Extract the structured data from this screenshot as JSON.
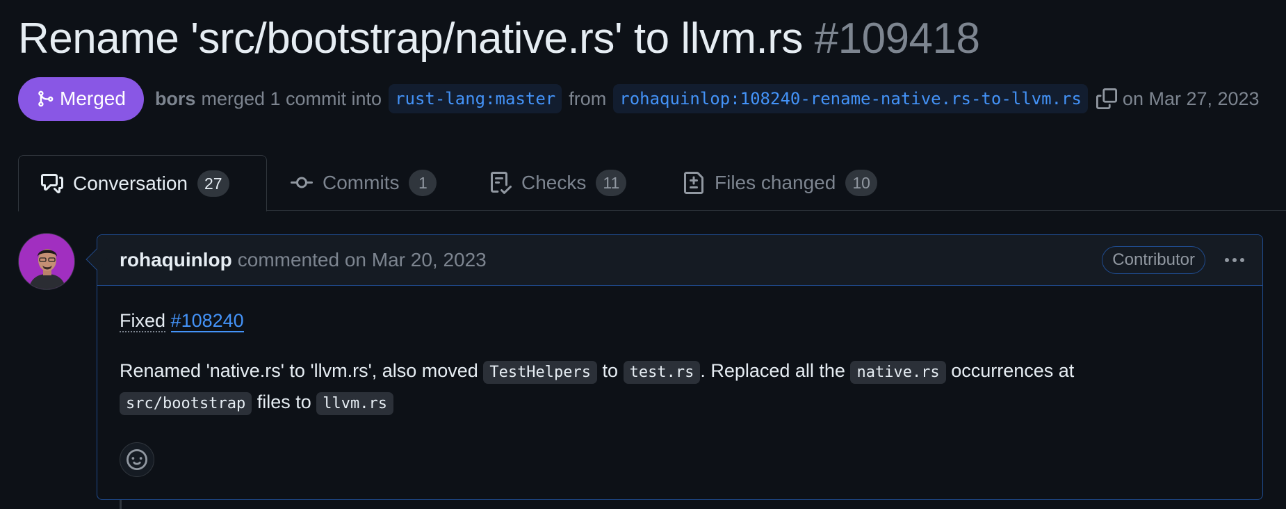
{
  "pr": {
    "title": "Rename 'src/bootstrap/native.rs' to llvm.rs",
    "number": "#109418",
    "state": "Merged",
    "author": "bors",
    "merged_text": "merged 1 commit into",
    "base_branch": "rust-lang:master",
    "from_text": "from",
    "head_branch": "rohaquinlop:108240-rename-native.rs-to-llvm.rs",
    "date_text": "on Mar 27, 2023"
  },
  "tabs": [
    {
      "label": "Conversation",
      "count": "27",
      "icon": "comment-discussion-icon"
    },
    {
      "label": "Commits",
      "count": "1",
      "icon": "git-commit-icon"
    },
    {
      "label": "Checks",
      "count": "11",
      "icon": "checklist-icon"
    },
    {
      "label": "Files changed",
      "count": "10",
      "icon": "file-diff-icon"
    }
  ],
  "comment": {
    "author": "rohaquinlop",
    "meta": "commented on Mar 20, 2023",
    "badge": "Contributor",
    "fixed": "Fixed",
    "issue": "#108240",
    "body": {
      "t1": "Renamed 'native.rs' to 'llvm.rs', also moved",
      "c1": "TestHelpers",
      "t2": "to",
      "c2": "test.rs",
      "t3": ". Replaced all the",
      "c3": "native.rs",
      "t4": "occurrences at",
      "c4": "src/bootstrap",
      "t5": "files to",
      "c5": "llvm.rs"
    }
  },
  "colors": {
    "background": "#0d1117",
    "merged": "#8957e5",
    "link": "#4493f8",
    "comment_border": "#1f4a8c"
  }
}
